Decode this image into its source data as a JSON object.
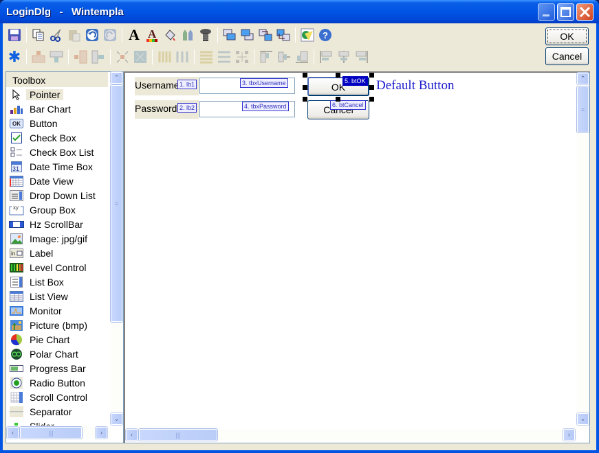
{
  "window": {
    "title": "LoginDlg   -   Wintempla",
    "controls": [
      "minimize",
      "maximize",
      "close"
    ]
  },
  "dialog_buttons": {
    "ok": "OK",
    "cancel": "Cancel"
  },
  "toolbar": {
    "row1": [
      "save",
      "copy",
      "cut",
      "paste",
      "undo",
      "redo",
      "font",
      "font-color",
      "fill-color",
      "colors",
      "properties",
      "bring-front",
      "send-back",
      "move-forward",
      "move-backward",
      "tab-order",
      "help"
    ],
    "row2": [
      "select-all",
      "same-width",
      "same-width-center",
      "same-height",
      "same-height-center",
      "shrink",
      "expand",
      "space-horizontal",
      "space-horizontal-even",
      "space-vertical",
      "space-vertical-even",
      "grid",
      "align-top",
      "align-middle",
      "align-bottom",
      "align-left",
      "align-center",
      "align-right"
    ]
  },
  "toolbox": {
    "title": "Toolbox",
    "items": [
      {
        "label": "Pointer",
        "icon": "pointer-icon",
        "selected": true
      },
      {
        "label": "Bar Chart",
        "icon": "bar-chart-icon"
      },
      {
        "label": "Button",
        "icon": "button-icon"
      },
      {
        "label": "Check Box",
        "icon": "check-box-icon"
      },
      {
        "label": "Check Box List",
        "icon": "check-box-list-icon"
      },
      {
        "label": "Date Time Box",
        "icon": "calendar-icon"
      },
      {
        "label": "Date View",
        "icon": "date-view-icon"
      },
      {
        "label": "Drop Down List",
        "icon": "drop-down-icon"
      },
      {
        "label": "Group Box",
        "icon": "group-box-icon"
      },
      {
        "label": "Hz ScrollBar",
        "icon": "hscrollbar-icon"
      },
      {
        "label": "Image: jpg/gif",
        "icon": "image-icon"
      },
      {
        "label": "Label",
        "icon": "label-icon"
      },
      {
        "label": "Level Control",
        "icon": "level-icon"
      },
      {
        "label": "List Box",
        "icon": "list-box-icon"
      },
      {
        "label": "List View",
        "icon": "list-view-icon"
      },
      {
        "label": "Monitor",
        "icon": "monitor-icon"
      },
      {
        "label": "Picture (bmp)",
        "icon": "picture-icon"
      },
      {
        "label": "Pie Chart",
        "icon": "pie-chart-icon"
      },
      {
        "label": "Polar Chart",
        "icon": "polar-chart-icon"
      },
      {
        "label": "Progress Bar",
        "icon": "progress-bar-icon"
      },
      {
        "label": "Radio Button",
        "icon": "radio-button-icon"
      },
      {
        "label": "Scroll Control",
        "icon": "scroll-control-icon"
      },
      {
        "label": "Separator",
        "icon": "separator-icon"
      },
      {
        "label": "Slider",
        "icon": "slider-icon"
      }
    ]
  },
  "design": {
    "lb1": {
      "text": "Username",
      "tag": "1. lb1"
    },
    "lb2": {
      "text": "Password",
      "tag": "2. lb2"
    },
    "tbxUsername": {
      "value": "",
      "tag": "3. tbxUsername"
    },
    "tbxPassword": {
      "value": "",
      "tag": "4. tbxPassword"
    },
    "btOK": {
      "text": "OK",
      "tag": "5. btOK"
    },
    "btCancel": {
      "text": "Cancel",
      "tag": "6. btCancel"
    },
    "default_label": "Default Button"
  },
  "scroll_glyphs": {
    "up": "⌃",
    "down": "⌄",
    "left": "‹",
    "right": "›",
    "grip_v": "≡",
    "grip_h": "|||"
  }
}
